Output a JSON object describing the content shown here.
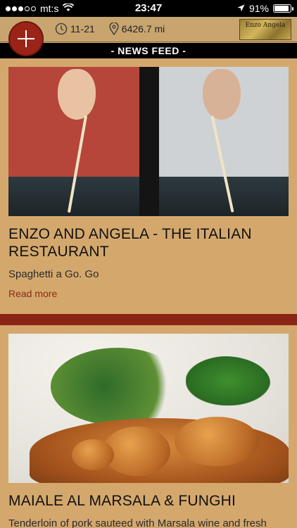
{
  "status_bar": {
    "carrier": "mt:s",
    "time": "23:47",
    "battery": "91%",
    "battery_level": 0.91,
    "signal_bars_filled": 3,
    "signal_bars_total": 5
  },
  "header": {
    "date": "11-21",
    "distance": "6426.7 mi",
    "add_button_icon": "plus-icon",
    "logo_text": "Enzo Angela",
    "accent_color": "#9a2418"
  },
  "section": {
    "title": "- NEWS FEED -"
  },
  "feed": {
    "items": [
      {
        "title": "ENZO AND ANGELA - THE ITALIAN RESTAURANT",
        "description": "Spaghetti a Go. Go",
        "link": "Read more"
      },
      {
        "title": "MAIALE AL MARSALA & FUNGHI",
        "description": "Tenderloin of pork sauteed with Marsala wine and fresh mushrooms"
      }
    ]
  }
}
